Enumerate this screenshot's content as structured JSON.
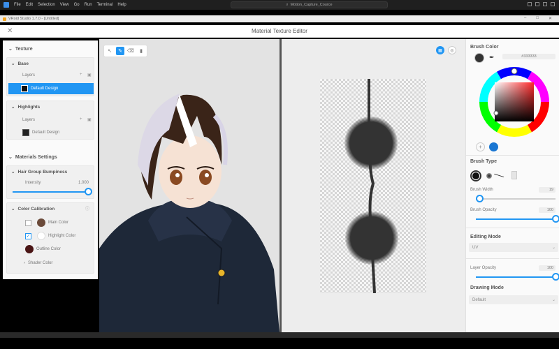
{
  "vscode": {
    "menus": [
      "File",
      "Edit",
      "Selection",
      "View",
      "Go",
      "Run",
      "Terminal",
      "Help"
    ],
    "command_center": "Motion_Capture_Cource"
  },
  "app": {
    "title": "VRoid Studio 1.7.0 - [Untitled]"
  },
  "editor": {
    "title": "Material Texture Editor"
  },
  "left": {
    "texture_label": "Texture",
    "base": {
      "label": "Base",
      "layers_label": "Layers",
      "layer_name": "Default Design"
    },
    "highlights": {
      "label": "Highlights",
      "layers_label": "Layers",
      "layer_name": "Default Design"
    },
    "materials_label": "Materials Settings",
    "bumpiness": {
      "label": "Hair Group Bumpiness",
      "intensity_label": "Intensity",
      "intensity_value": "1.000",
      "level": 1.0
    },
    "calibration": {
      "label": "Color Calibration",
      "items": [
        {
          "label": "Main Color",
          "checked": false,
          "color": "#6b4a3a"
        },
        {
          "label": "Highlight Color",
          "checked": true,
          "color": "#ffffff"
        },
        {
          "label": "Outline Color",
          "color": "#4a1515"
        }
      ],
      "shader_label": "Shader Color"
    }
  },
  "right": {
    "brush_color_label": "Brush Color",
    "hex_value": "#333333",
    "current_color": "#333333",
    "brush_type_label": "Brush Type",
    "brush_width_label": "Brush Width",
    "brush_width_value": "19",
    "brush_width_level": 0.05,
    "brush_opacity_label": "Brush Opacity",
    "brush_opacity_value": "100",
    "brush_opacity_level": 1.0,
    "editing_mode_label": "Editing Mode",
    "editing_mode_value": "UV",
    "layer_opacity_label": "Layer Opacity",
    "layer_opacity_value": "100",
    "layer_opacity_level": 1.0,
    "drawing_mode_label": "Drawing Mode",
    "drawing_mode_value": "Default"
  },
  "colors": {
    "accent": "#2196f3",
    "stroke": "#333333"
  }
}
